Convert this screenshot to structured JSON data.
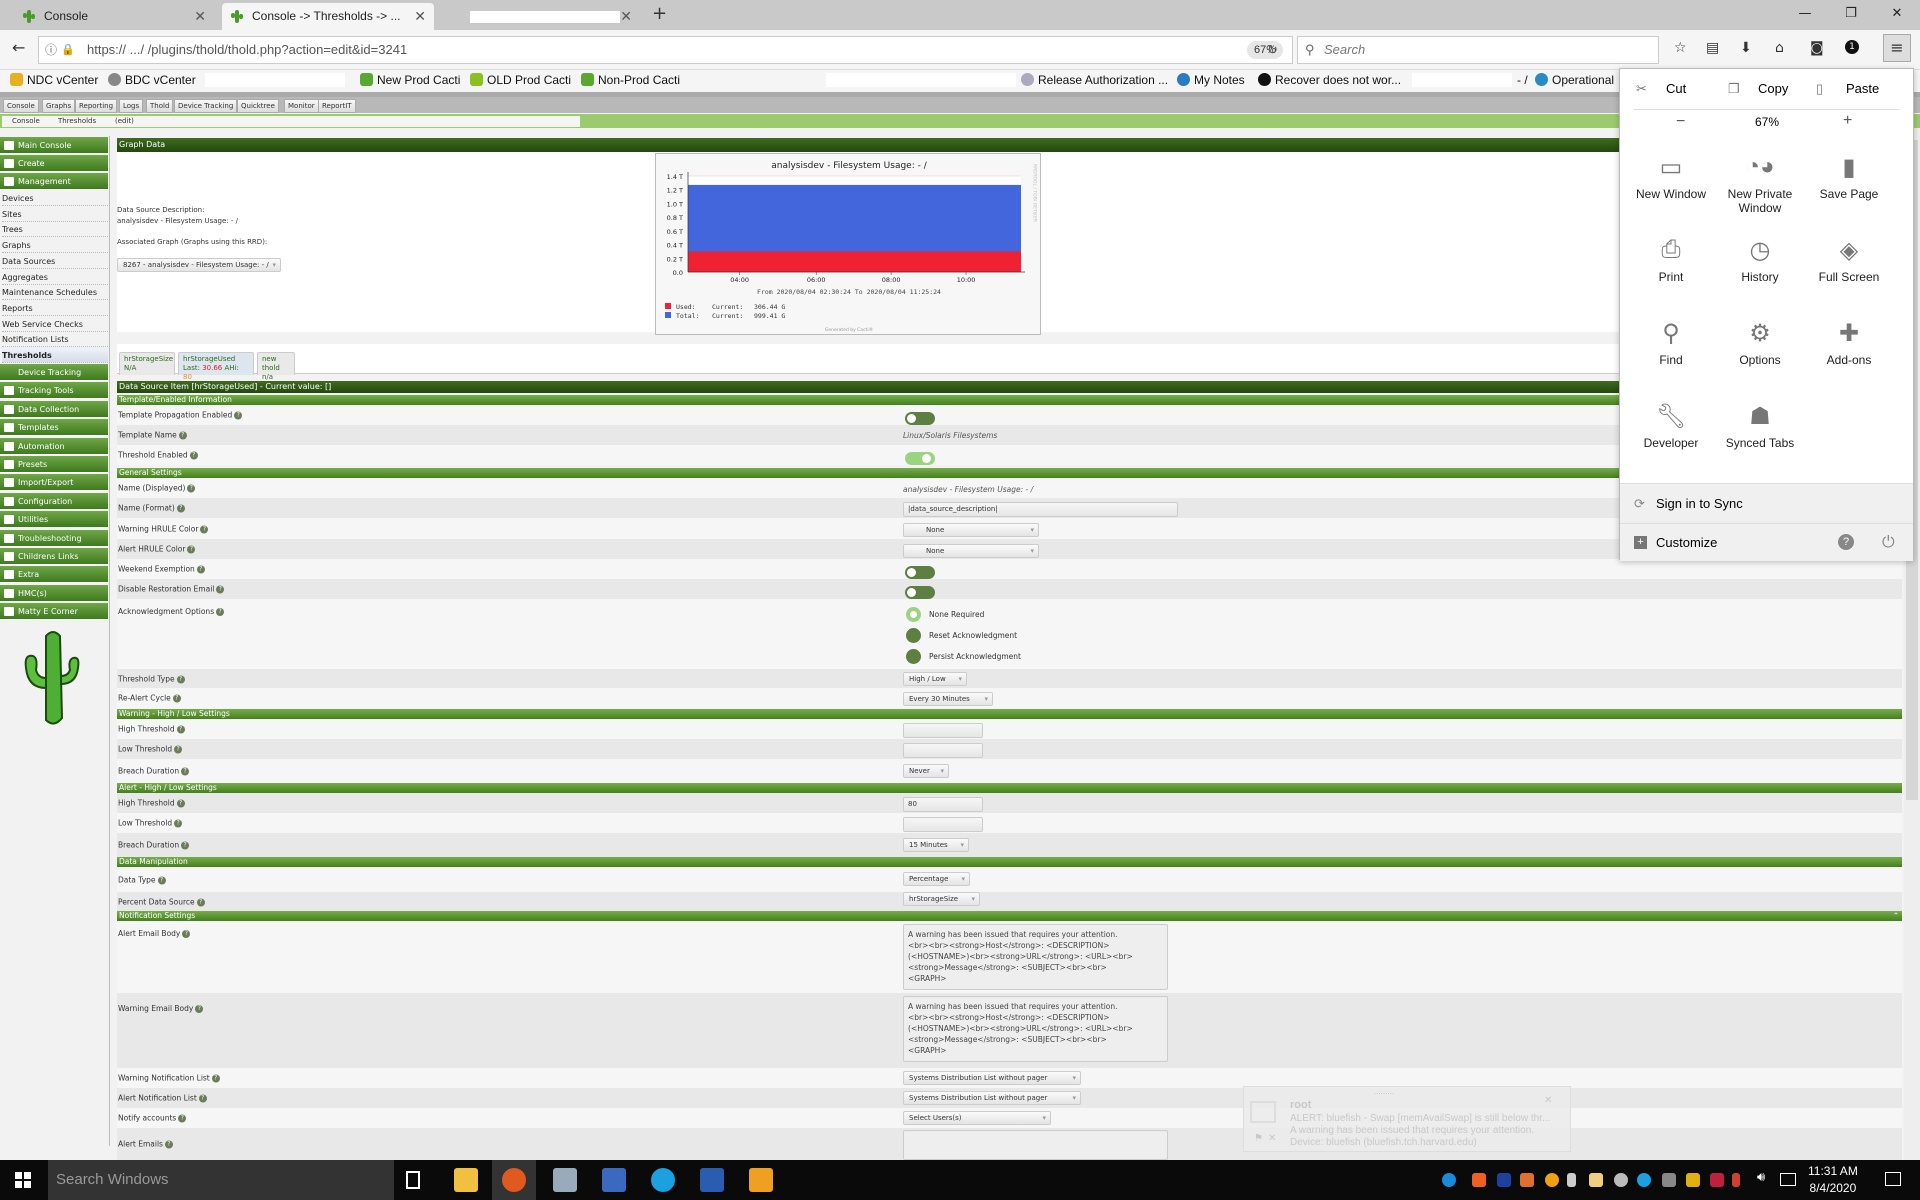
{
  "browser": {
    "tabs": [
      {
        "title": "Console",
        "active": false
      },
      {
        "title": "Console -> Thresholds -> ...",
        "active": true
      },
      {
        "title": "",
        "active": false
      }
    ],
    "new_tab": "+",
    "url": "https://  .../  /plugins/thold/thold.php?action=edit&id=3241",
    "zoom": "67%",
    "search_placeholder": "Search",
    "bookmarks": [
      "NDC vCenter",
      "BDC vCenter",
      "",
      "New Prod Cacti",
      "OLD Prod Cacti",
      "Non-Prod Cacti",
      "",
      "Release Authorization ...",
      "My Notes",
      "Recover does not wor...",
      "- /",
      "Operational"
    ],
    "window_controls": [
      "—",
      "❐",
      "✕"
    ]
  },
  "cacti": {
    "top_tabs": [
      "Console",
      "Graphs",
      "Reporting",
      "Logs",
      "Thold",
      "Device Tracking",
      "Quicktree",
      "Monitor",
      "ReportIT"
    ],
    "breadcrumbs": [
      "Console",
      "Thresholds",
      "(edit)"
    ],
    "sidebar": {
      "groups_top": [
        {
          "label": "Main Console"
        },
        {
          "label": "Create"
        },
        {
          "label": "Management"
        }
      ],
      "management_items": [
        "Devices",
        "Sites",
        "Trees",
        "Graphs",
        "Data Sources",
        "Aggregates",
        "Maintenance Schedules",
        "Reports",
        "Web Service Checks",
        "Notification Lists",
        "Thresholds"
      ],
      "groups_bottom": [
        "Device Tracking",
        "Tracking Tools",
        "Data Collection",
        "Templates",
        "Automation",
        "Presets",
        "Import/Export",
        "Configuration",
        "Utilities",
        "Troubleshooting",
        "Childrens Links",
        "Extra",
        "HMC(s)",
        "Matty E Corner"
      ]
    },
    "graph_data": {
      "header": "Graph Data",
      "ds_desc_label": "Data Source Description:",
      "ds_desc_value": "analysisdev - Filesystem Usage: - /",
      "assoc_label": "Associated Graph (Graphs using this RRD):",
      "assoc_value": "8267 - analysisdev - Filesystem Usage: - /"
    },
    "thold_tabs": [
      {
        "name": "hrStorageSize",
        "value": "N/A"
      },
      {
        "name": "hrStorageUsed",
        "last_label": "Last:",
        "last": "30.66",
        "ahi_label": "AHi:",
        "ahi": "80"
      },
      {
        "name": "new thold",
        "value": "n/a"
      }
    ],
    "ds_header": "Data Source Item [hrStorageUsed] - Current value: []",
    "sections": {
      "template": "Template/Enabled Information",
      "general": "General Settings",
      "warning": "Warning - High / Low Settings",
      "alert": "Alert - High / Low Settings",
      "manip": "Data Manipulation",
      "notify": "Notification Settings"
    },
    "fields": {
      "template_propagation": {
        "label": "Template Propagation Enabled",
        "on": false
      },
      "template_name": {
        "label": "Template Name",
        "value": "Linux/Solaris Filesystems"
      },
      "threshold_enabled": {
        "label": "Threshold Enabled",
        "on": true
      },
      "name_displayed": {
        "label": "Name (Displayed)",
        "value": "analysisdev - Filesystem Usage: - /"
      },
      "name_format": {
        "label": "Name (Format)",
        "value": "|data_source_description|"
      },
      "warning_hrule": {
        "label": "Warning HRULE Color",
        "value": "None"
      },
      "alert_hrule": {
        "label": "Alert HRULE Color",
        "value": "None"
      },
      "weekend_exemption": {
        "label": "Weekend Exemption",
        "on": false
      },
      "disable_restoration": {
        "label": "Disable Restoration Email",
        "on": false
      },
      "ack_options": {
        "label": "Acknowledgment Options",
        "options": [
          "None Required",
          "Reset Acknowledgment",
          "Persist Acknowledgment"
        ],
        "selected": 0
      },
      "threshold_type": {
        "label": "Threshold Type",
        "value": "High / Low"
      },
      "realert": {
        "label": "Re-Alert Cycle",
        "value": "Every 30 Minutes"
      },
      "warn_high": {
        "label": "High Threshold",
        "value": ""
      },
      "warn_low": {
        "label": "Low Threshold",
        "value": ""
      },
      "warn_breach": {
        "label": "Breach Duration",
        "value": "Never"
      },
      "alert_high": {
        "label": "High Threshold",
        "value": "80"
      },
      "alert_low": {
        "label": "Low Threshold",
        "value": ""
      },
      "alert_breach": {
        "label": "Breach Duration",
        "value": "15 Minutes"
      },
      "data_type": {
        "label": "Data Type",
        "value": "Percentage"
      },
      "percent_ds": {
        "label": "Percent Data Source",
        "value": "hrStorageSize"
      },
      "alert_body": {
        "label": "Alert Email Body",
        "value": "A warning has been issued that requires your attention.\n<br><br><strong>Host</strong>: <DESCRIPTION>\n(<HOSTNAME>)<br><strong>URL</strong>: <URL><br>\n<strong>Message</strong>: <SUBJECT><br><br>\n<GRAPH>"
      },
      "warning_body": {
        "label": "Warning Email Body",
        "value": "A warning has been issued that requires your attention.\n<br><br><strong>Host</strong>: <DESCRIPTION>\n(<HOSTNAME>)<br><strong>URL</strong>: <URL><br>\n<strong>Message</strong>: <SUBJECT><br><br>\n<GRAPH>"
      },
      "warning_list": {
        "label": "Warning Notification List",
        "value": "Systems Distribution List without pager"
      },
      "alert_list": {
        "label": "Alert Notification List",
        "value": "Systems Distribution List without pager"
      },
      "notify_accounts": {
        "label": "Notify accounts",
        "value": "Select Users(s)"
      },
      "alert_emails": {
        "label": "Alert Emails",
        "value": ""
      }
    }
  },
  "chart_data": {
    "type": "area",
    "title": "analysisdev - Filesystem Usage: - /",
    "x": [
      "04:00",
      "06:00",
      "08:00",
      "10:00"
    ],
    "yticks": [
      "0.0",
      "0.2 T",
      "0.4 T",
      "0.6 T",
      "0.8 T",
      "1.0 T",
      "1.2 T",
      "1.4 T"
    ],
    "ylim": [
      0,
      1.4
    ],
    "series": [
      {
        "name": "Total",
        "color": "#4466dd",
        "value_T": 1.27
      },
      {
        "name": "Used",
        "color": "#ee2233",
        "value_T": 0.3
      }
    ],
    "range_text": "From 2020/08/04 02:30:24 To 2020/08/04 11:25:24",
    "legend": [
      {
        "name": "Used:",
        "label": "Current:",
        "value": "306.44 G",
        "color": "#ee2233"
      },
      {
        "name": "Total:",
        "label": "Current:",
        "value": "999.41 G",
        "color": "#4466dd"
      }
    ],
    "footer": "Generated by Cacti®",
    "side_text": "RRDTOOL / TOBI OETIKER"
  },
  "firefox_menu": {
    "edit": [
      "Cut",
      "Copy",
      "Paste"
    ],
    "zoom": {
      "minus": "−",
      "value": "67%",
      "plus": "+"
    },
    "items": [
      "New Window",
      "New Private Window",
      "Save Page",
      "Print",
      "History",
      "Full Screen",
      "Find",
      "Options",
      "Add-ons",
      "Developer",
      "Synced Tabs"
    ],
    "sync": "Sign in to Sync",
    "customize": "Customize"
  },
  "notification": {
    "from": "root",
    "subject": "ALERT: bluefish - Swap [memAvailSwap] is still below thr...",
    "line1": "A warning has been issued that requires your attention.",
    "line2": "Device: bluefish (bluefish.tch.harvard.edu)"
  },
  "taskbar": {
    "search": "Search Windows",
    "time": "11:31 AM",
    "date": "8/4/2020"
  }
}
